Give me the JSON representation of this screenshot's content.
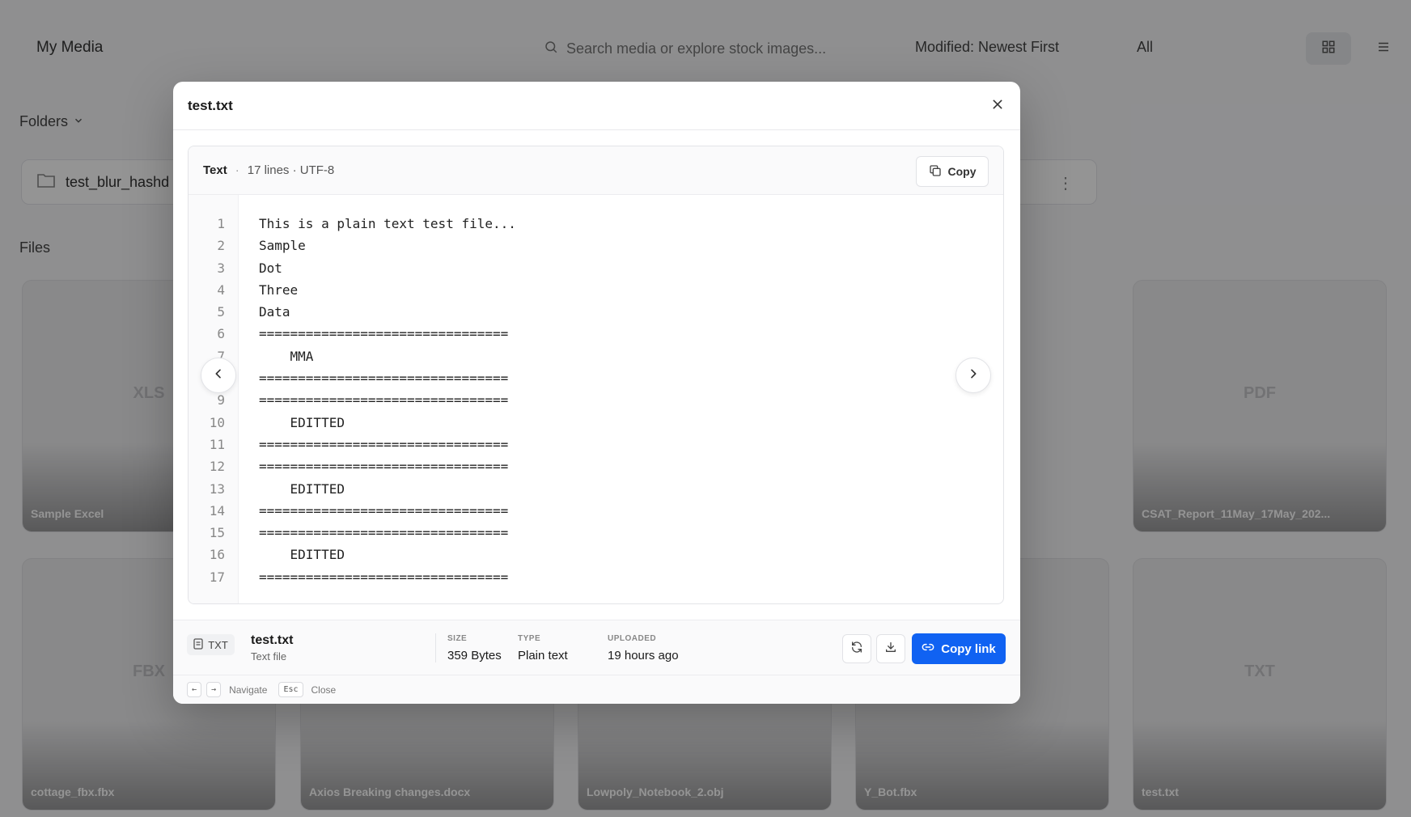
{
  "background": {
    "title": "My Media",
    "search_placeholder": "Search media or explore stock images...",
    "sort_label": "Modified: Newest First",
    "filter_label": "All",
    "folders_label": "Folders",
    "folder_name": "test_blur_hashd",
    "files_label": "Files",
    "cards_row1": [
      {
        "ext": "XLS",
        "name": "Sample Excel"
      },
      {
        "ext": "PDF",
        "name": "CSAT_Report_11May_17May_202..."
      }
    ],
    "cards_row2": [
      {
        "ext": "FBX",
        "name": "cottage_fbx.fbx"
      },
      {
        "ext": "",
        "name": "Axios Breaking changes.docx"
      },
      {
        "ext": "",
        "name": "Lowpoly_Notebook_2.obj"
      },
      {
        "ext": "",
        "name": "Y_Bot.fbx"
      },
      {
        "ext": "TXT",
        "name": "test.txt"
      }
    ]
  },
  "modal": {
    "title": "test.txt",
    "viewer": {
      "kind": "Text",
      "separator": "·",
      "meta": "17 lines · UTF-8",
      "copy_label": "Copy",
      "lines": [
        "This is a plain text test file...",
        "Sample",
        "Dot",
        "Three",
        "Data",
        "================================",
        "    MMA",
        "================================",
        "================================",
        "    EDITTED",
        "================================",
        "================================",
        "    EDITTED",
        "================================",
        "================================",
        "    EDITTED",
        "================================"
      ]
    },
    "footer": {
      "badge": "TXT",
      "file_name": "test.txt",
      "file_desc": "Text file",
      "size_label": "SIZE",
      "size_value": "359 Bytes",
      "type_label": "TYPE",
      "type_value": "Plain text",
      "uploaded_label": "UPLOADED",
      "uploaded_value": "19 hours ago",
      "copy_link_label": "Copy link"
    },
    "hints": {
      "prev_key": "←",
      "next_key": "→",
      "navigate_label": "Navigate",
      "esc_key": "Esc",
      "close_label": "Close"
    }
  },
  "colors": {
    "accent": "#1062f2",
    "overlay": "rgba(0,0,0,0.42)"
  }
}
